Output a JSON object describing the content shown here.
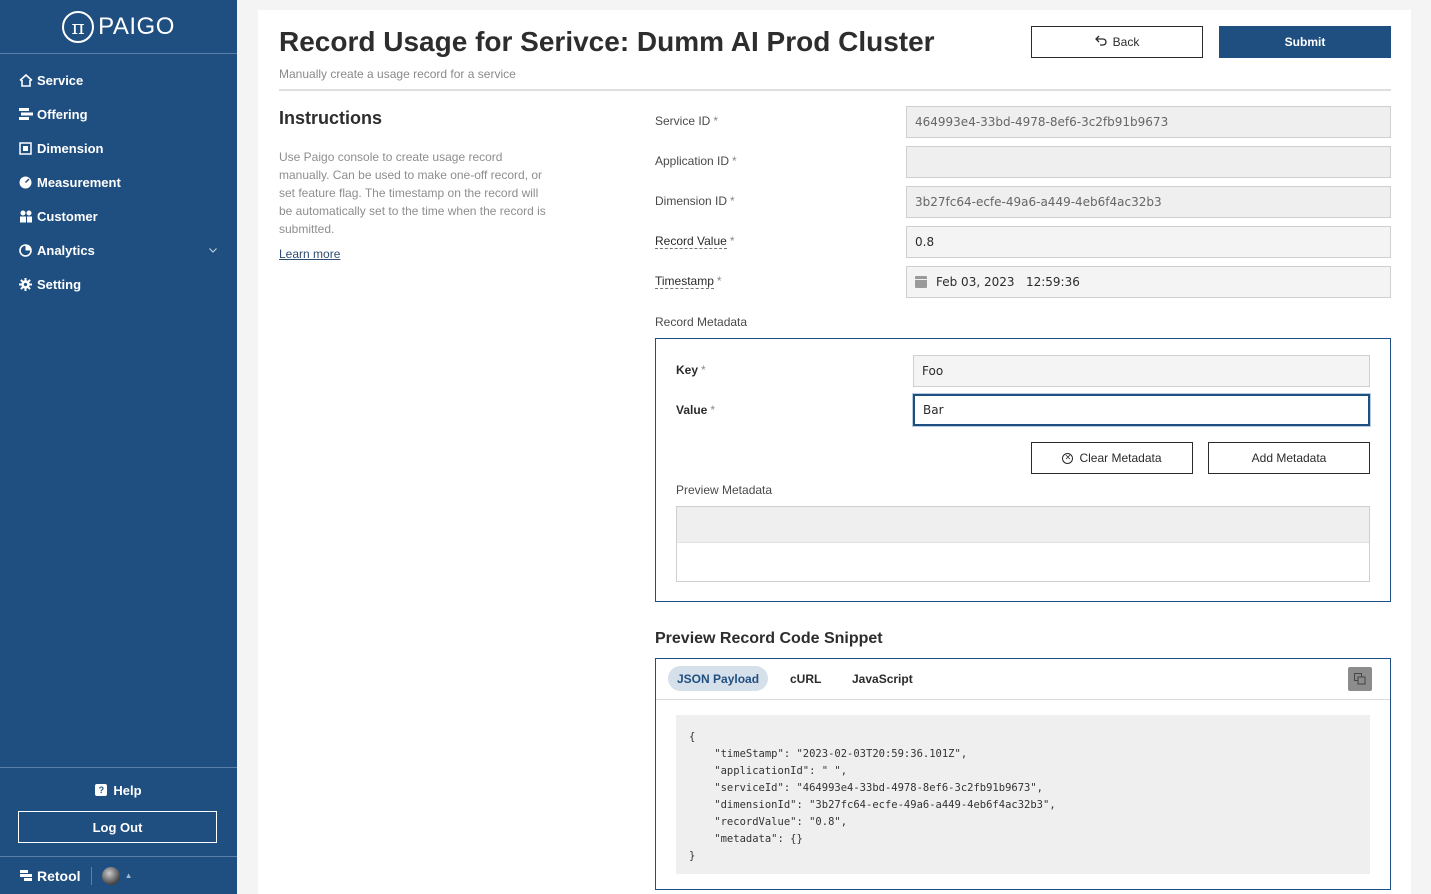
{
  "sidebar": {
    "logo_mark": "π",
    "logo_text": "PAIGO",
    "items": [
      {
        "label": "Service",
        "icon": "home-icon"
      },
      {
        "label": "Offering",
        "icon": "offering-icon"
      },
      {
        "label": "Dimension",
        "icon": "dimension-icon"
      },
      {
        "label": "Measurement",
        "icon": "measurement-icon"
      },
      {
        "label": "Customer",
        "icon": "customer-icon"
      },
      {
        "label": "Analytics",
        "icon": "analytics-icon"
      },
      {
        "label": "Setting",
        "icon": "gear-icon"
      }
    ],
    "help_badge": "?",
    "help_label": "Help",
    "logout_label": "Log Out",
    "retool_label": "Retool"
  },
  "header": {
    "title": "Record Usage for Serivce: Dumm AI Prod Cluster",
    "subtitle": "Manually create a usage record for a service",
    "back_label": "Back",
    "submit_label": "Submit"
  },
  "instructions": {
    "title": "Instructions",
    "text": "Use Paigo console to create usage record manually. Can be used to make one-off record, or set feature flag. The timestamp on the record will be automatically set to the time when the record is submitted.",
    "learn_more": "Learn more"
  },
  "form": {
    "service_id_label": "Service ID",
    "service_id_value": "464993e4-33bd-4978-8ef6-3c2fb91b9673",
    "application_id_label": "Application ID",
    "application_id_value": "",
    "dimension_id_label": "Dimension ID",
    "dimension_id_value": "3b27fc64-ecfe-49a6-a449-4eb6f4ac32b3",
    "record_value_label": "Record Value",
    "record_value_value": "0.8",
    "timestamp_label": "Timestamp",
    "timestamp_value": "Feb 03, 2023   12:59:36",
    "required_mark": "*"
  },
  "metadata": {
    "section_label": "Record Metadata",
    "key_label": "Key",
    "key_value": "Foo",
    "value_label": "Value",
    "value_value": "Bar",
    "clear_label": "Clear Metadata",
    "add_label": "Add Metadata",
    "preview_label": "Preview Metadata"
  },
  "snippet": {
    "title": "Preview Record Code Snippet",
    "tabs": [
      "JSON Payload",
      "cURL",
      "JavaScript"
    ],
    "code": "{\n    \"timeStamp\": \"2023-02-03T20:59:36.101Z\",\n    \"applicationId\": \" \",\n    \"serviceId\": \"464993e4-33bd-4978-8ef6-3c2fb91b9673\",\n    \"dimensionId\": \"3b27fc64-ecfe-49a6-a449-4eb6f4ac32b3\",\n    \"recordValue\": \"0.8\",\n    \"metadata\": {}\n}"
  },
  "colors": {
    "brand": "#1f4f80",
    "active_tab_bg": "#d6e0ea"
  }
}
